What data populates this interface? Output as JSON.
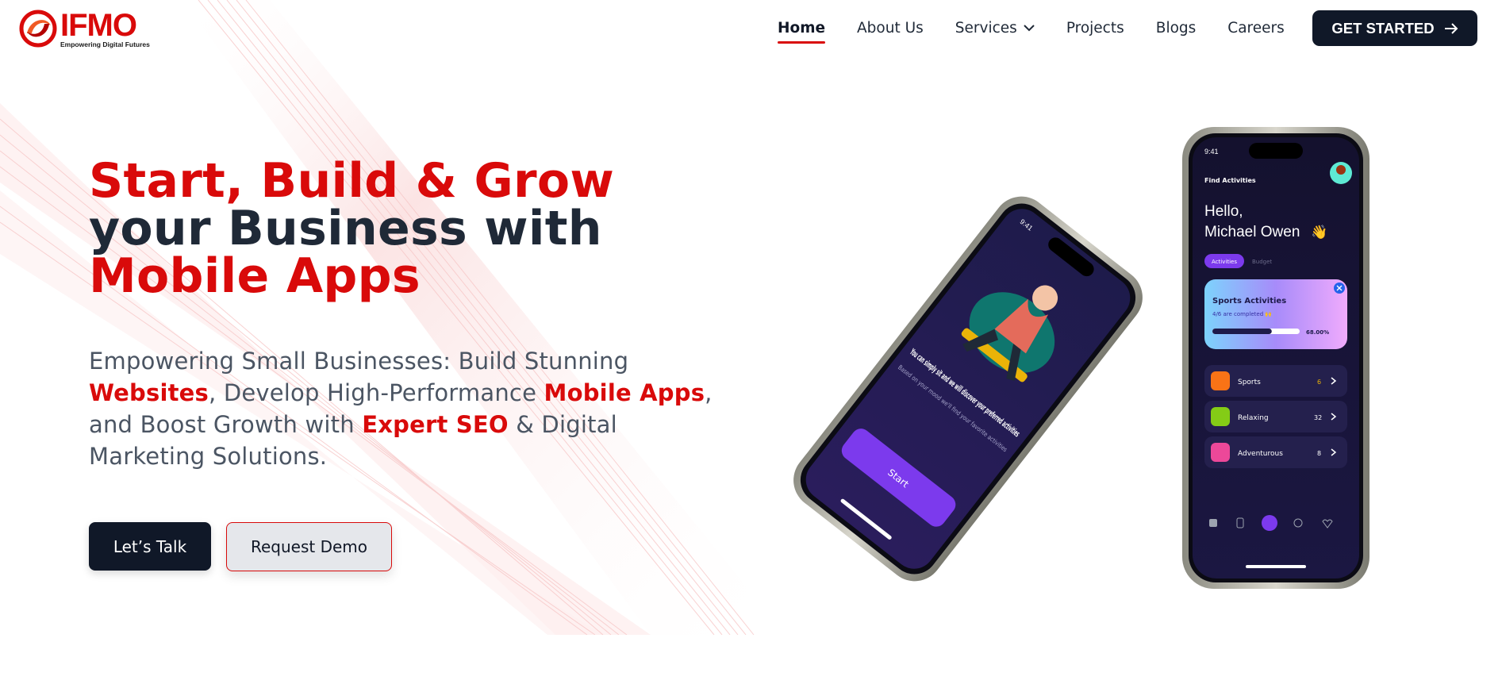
{
  "brand": {
    "name": "IFMO",
    "tagline": "Empowering Digital Futures",
    "accent": "#d90a0a",
    "dark": "#101828"
  },
  "nav": {
    "items": [
      {
        "label": "Home",
        "active": true
      },
      {
        "label": "About Us"
      },
      {
        "label": "Services",
        "icon": "chevron-down-icon"
      },
      {
        "label": "Projects"
      },
      {
        "label": "Blogs"
      },
      {
        "label": "Careers"
      }
    ],
    "cta_label": "GET STARTED",
    "cta_icon": "arrow-right-icon"
  },
  "hero": {
    "title_line1": "Start, Build & Grow",
    "title_line2": "your Business with",
    "title_line3": "Mobile Apps",
    "subtitle": {
      "p1": "Empowering Small Businesses: Build Stunning",
      "hl1": "Websites",
      "p2": ", Develop High-Performance",
      "hl2": "Mobile Apps",
      "p3": ", and Boost Growth with",
      "hl3": "Expert SEO",
      "p4": "& Digital Marketing Solutions."
    },
    "primary_button": "Let’s Talk",
    "secondary_button": "Request Demo"
  },
  "phone_left": {
    "status_time": "9:41",
    "headline": "You can simply sit and we will discover your preferred activities",
    "body": "Based on your mood we'll find your favorite activities",
    "button": "Start"
  },
  "phone_right": {
    "status_time": "9:41",
    "header": "Find Activities",
    "greeting_line1": "Hello,",
    "greeting_line2": "Michael Owen",
    "wave_emoji": "👋",
    "tabs": [
      "Activities",
      "Budget"
    ],
    "card": {
      "title": "Sports Activities",
      "subtitle": "4/6 are completed 🙌",
      "progress_label": "68.00%",
      "progress": 0.68
    },
    "activities": [
      {
        "name": "Sports",
        "count": "6",
        "color": "#f97316"
      },
      {
        "name": "Relaxing",
        "count": "32",
        "color": "#84cc16"
      },
      {
        "name": "Adventurous",
        "count": "8",
        "color": "#ec4899"
      }
    ]
  }
}
